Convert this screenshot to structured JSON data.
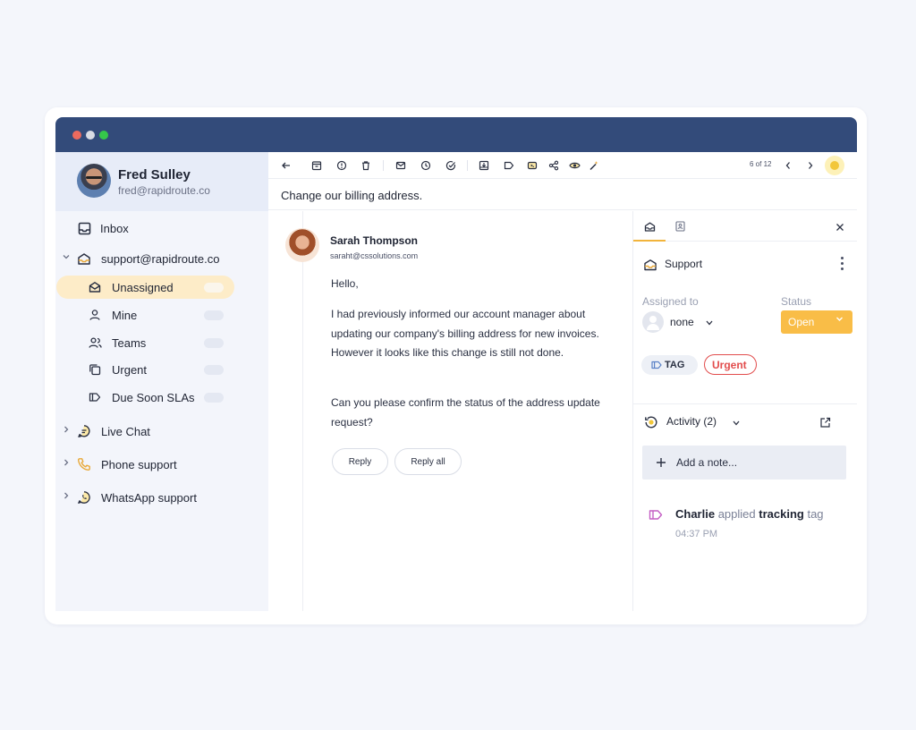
{
  "profile": {
    "name": "Fred Sulley",
    "email": "fred@rapidroute.co"
  },
  "nav": {
    "inbox": "Inbox",
    "mailbox": "support@rapidroute.co",
    "subitems": [
      {
        "label": "Unassigned"
      },
      {
        "label": "Mine"
      },
      {
        "label": "Teams"
      },
      {
        "label": "Urgent"
      },
      {
        "label": "Due Soon SLAs"
      }
    ],
    "channels": [
      {
        "label": "Live Chat"
      },
      {
        "label": "Phone support"
      },
      {
        "label": "WhatsApp support"
      }
    ]
  },
  "toolbar": {
    "pager": "6 of 12"
  },
  "conversation": {
    "subject": "Change our billing address.",
    "sender_name": "Sarah Thompson",
    "sender_email": "saraht@cssolutions.com",
    "greeting": "Hello,",
    "paragraph1": "I had previously informed our account manager about updating our company's billing address for new invoices. However it looks like this change is still not done.",
    "paragraph2": "Can you please confirm the status of the address update request?",
    "reply_label": "Reply",
    "reply_all_label": "Reply all"
  },
  "details": {
    "inbox_label": "Support",
    "assigned_label": "Assigned to",
    "assignee": "none",
    "status_label": "Status",
    "status_value": "Open",
    "tags": [
      "TAG",
      "Urgent"
    ],
    "activity_label": "Activity (2)",
    "add_note": "Add a note...",
    "activity": {
      "actor": "Charlie",
      "verb": "applied",
      "object": "tracking",
      "suffix": "tag",
      "time": "04:37 PM"
    }
  },
  "colors": {
    "titlebar": "#334b7a",
    "accent": "#f9bd47",
    "urgent": "#e24d4d",
    "active_item": "#fdecc8"
  }
}
